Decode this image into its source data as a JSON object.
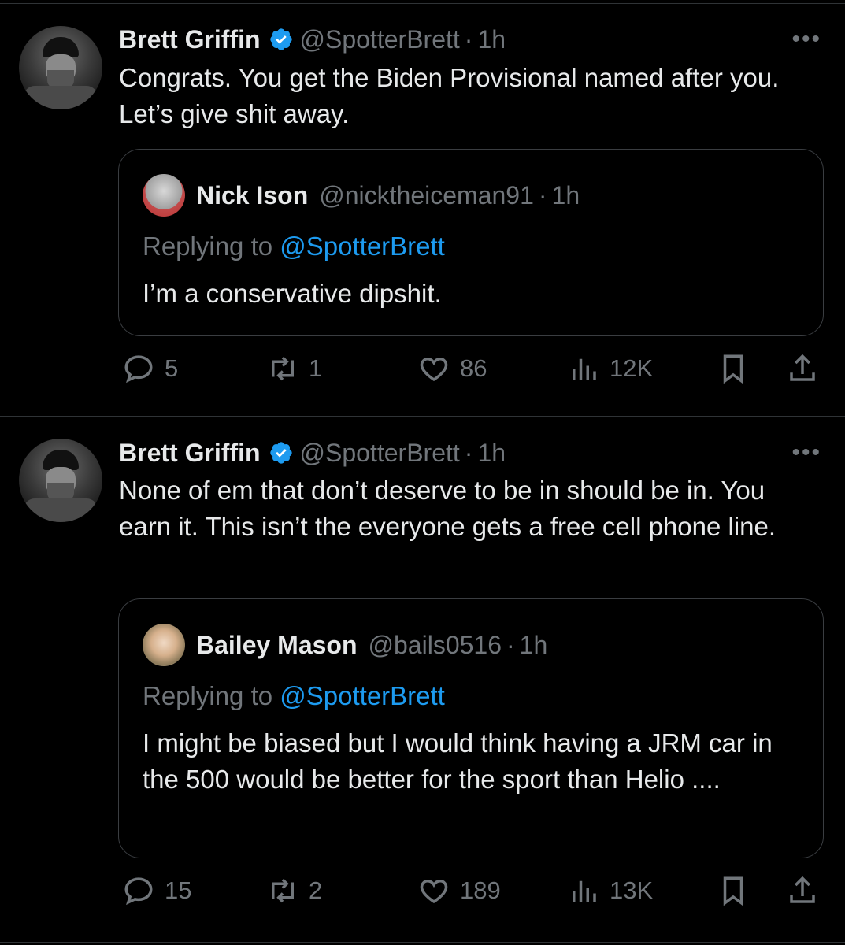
{
  "posts": [
    {
      "author": "Brett Griffin",
      "handle": "@SpotterBrett",
      "separator": "·",
      "time": "1h",
      "more": "•••",
      "text": "Congrats. You get the Biden Provisional named after you. Let’s give shit away.",
      "quote": {
        "author": "Nick Ison",
        "handle": "@nicktheiceman91",
        "time": "1h",
        "replying_prefix": "Replying to ",
        "replying_mention": "@SpotterBrett",
        "text": "I’m a conservative dipshit."
      },
      "stats": {
        "replies": "5",
        "reposts": "1",
        "likes": "86",
        "views": "12K"
      }
    },
    {
      "author": "Brett Griffin",
      "handle": "@SpotterBrett",
      "separator": "·",
      "time": "1h",
      "more": "•••",
      "text": "None of em that don’t deserve to be in should be in. You earn it. This isn’t the everyone gets a free cell phone line.",
      "quote": {
        "author": "Bailey Mason",
        "handle": "@bails0516",
        "time": "1h",
        "replying_prefix": "Replying to ",
        "replying_mention": "@SpotterBrett",
        "text": "I might be biased but I would think having a JRM car in the 500 would be better for the sport than Helio ...."
      },
      "stats": {
        "replies": "15",
        "reposts": "2",
        "likes": "189",
        "views": "13K"
      }
    }
  ],
  "colors": {
    "background": "#000000",
    "text": "#e7e9ea",
    "muted": "#71767b",
    "accent": "#1d9bf0",
    "border": "#2f3336"
  },
  "icons": [
    "verified-badge-icon",
    "more-icon",
    "reply-icon",
    "repost-icon",
    "like-icon",
    "views-icon",
    "bookmark-icon",
    "share-icon"
  ]
}
